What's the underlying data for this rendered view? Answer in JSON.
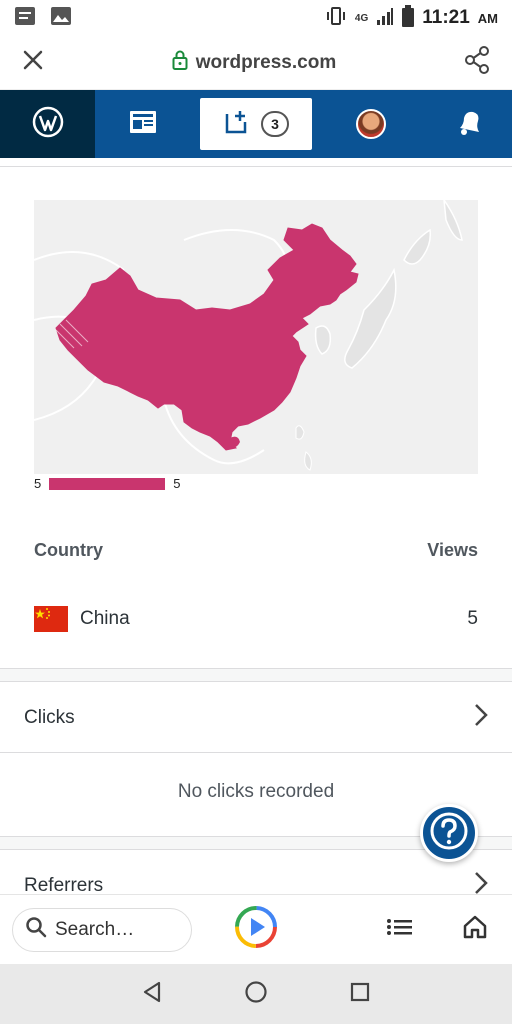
{
  "status_bar": {
    "time": "11:21",
    "ampm": "AM",
    "network": "4G"
  },
  "browser": {
    "url": "wordpress.com"
  },
  "wp_nav": {
    "notifications_count": "3"
  },
  "map": {
    "legend_min": "5",
    "legend_max": "5",
    "highlight_color": "#c9356e"
  },
  "table": {
    "col_country": "Country",
    "col_views": "Views",
    "rows": [
      {
        "country": "China",
        "views": "5"
      }
    ]
  },
  "sections": {
    "clicks_label": "Clicks",
    "clicks_empty": "No clicks recorded",
    "referrers_label": "Referrers"
  },
  "bottom_bar": {
    "search_placeholder": "Search…"
  },
  "colors": {
    "wp_blue": "#0b5394",
    "wp_dark": "#012a43",
    "accent": "#c9356e"
  }
}
